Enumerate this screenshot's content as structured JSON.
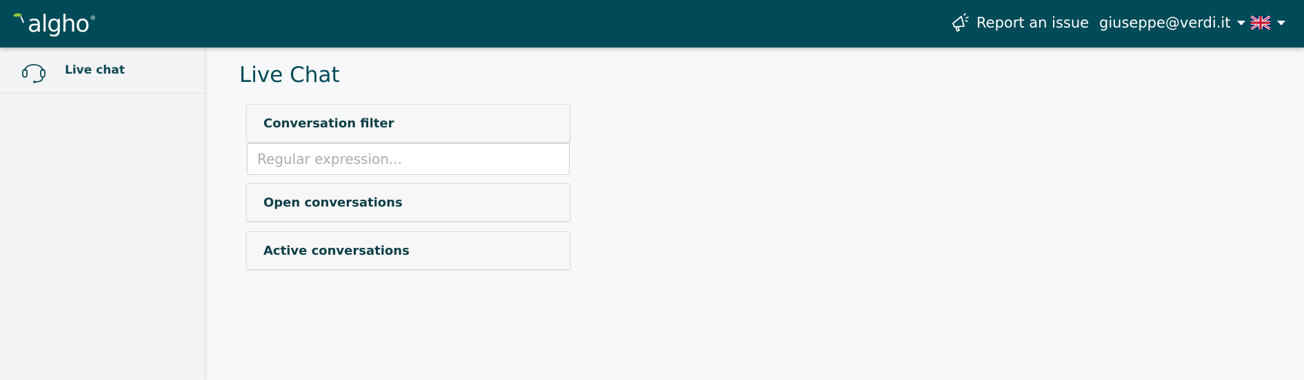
{
  "header": {
    "logo_text": "algho",
    "logo_reg": "®",
    "report_label": "Report an issue",
    "user_email": "giuseppe@verdi.it",
    "language_icon": "uk-flag-icon",
    "brand_color": "#004b57",
    "logo_leaf_color": "#8cc63f"
  },
  "sidebar": {
    "items": [
      {
        "label": "Live chat",
        "icon": "headset-icon"
      }
    ]
  },
  "main": {
    "title": "Live Chat",
    "filter": {
      "title": "Conversation filter",
      "placeholder": "Regular expression...",
      "value": ""
    },
    "panels": [
      {
        "title": "Open conversations"
      },
      {
        "title": "Active conversations"
      }
    ]
  }
}
